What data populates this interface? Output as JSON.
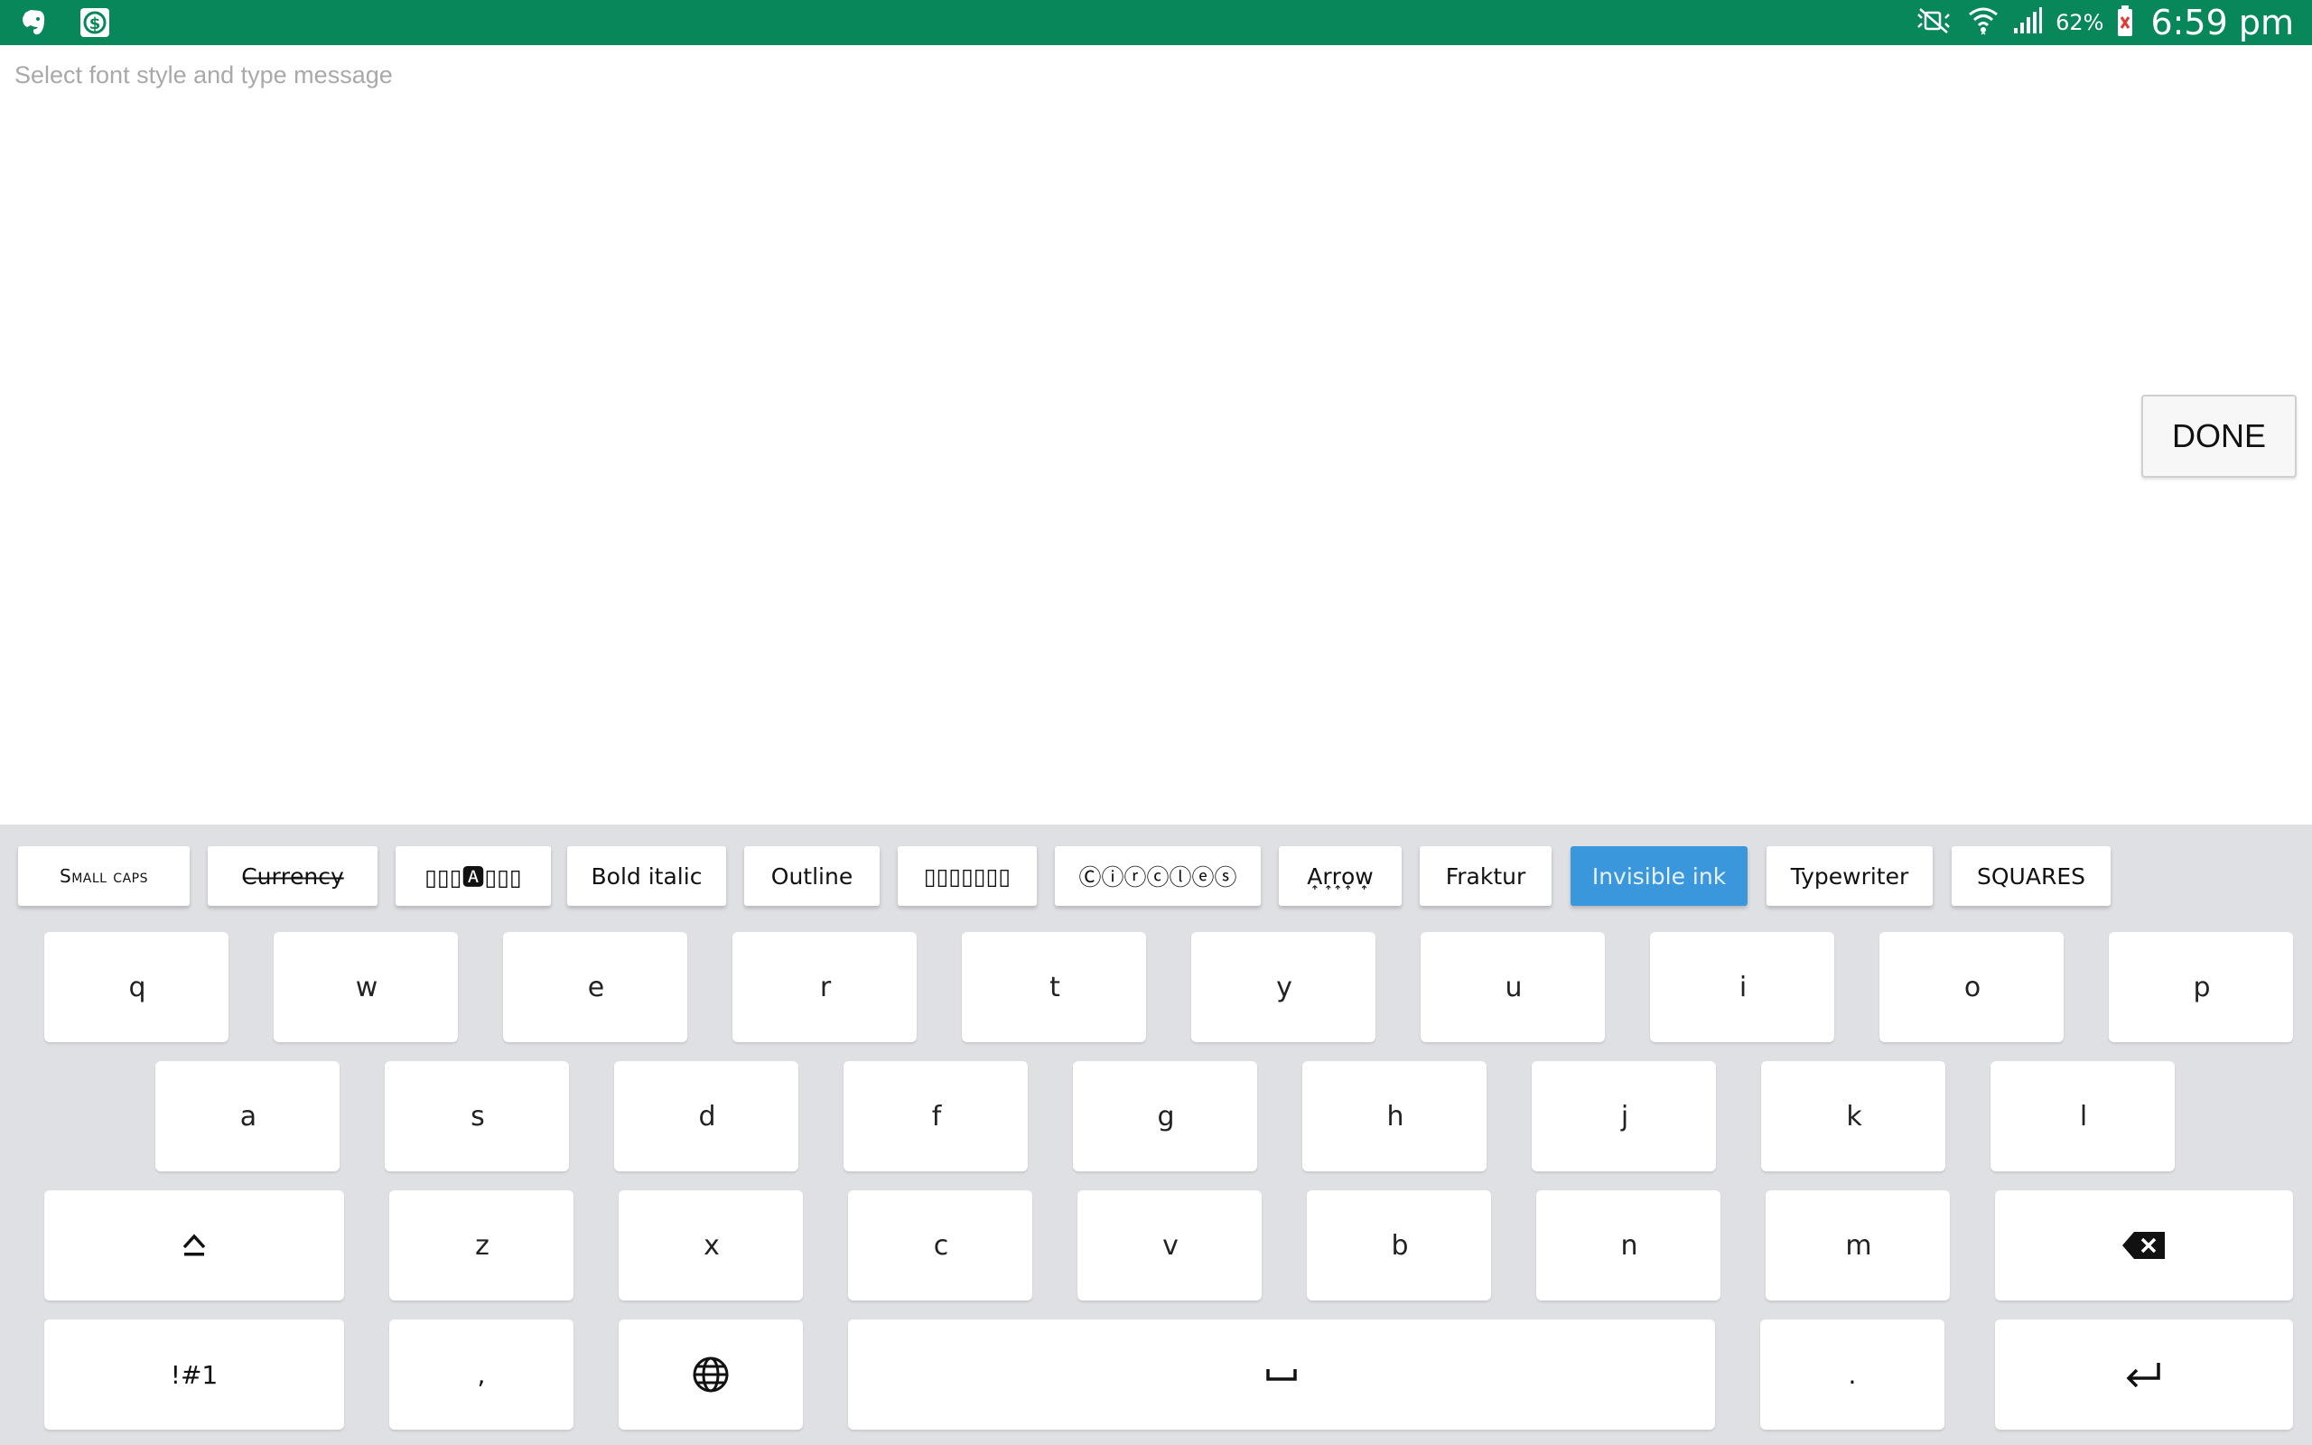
{
  "status_bar": {
    "left_icons": [
      "evernote-icon",
      "dollar-app-icon"
    ],
    "right_icons": [
      "mute-icon",
      "wifi-icon",
      "signal-icon",
      "battery-icon"
    ],
    "battery": "62%",
    "time": "6:59 pm"
  },
  "message": {
    "placeholder": "Select font style and type message",
    "value": ""
  },
  "done_label": "DONE",
  "colors": {
    "status_bar": "#07875a",
    "keyboard_bg": "#dfe0e4",
    "selected_chip": "#3b97dc"
  },
  "font_styles": [
    {
      "label": "Small caps",
      "selected": false
    },
    {
      "label": "C̶u̶r̶r̶e̶n̶c̶y̶",
      "selected": false
    },
    {
      "label": "▯▯▯🅰▯▯▯",
      "selected": false
    },
    {
      "label": "Bold italic",
      "selected": false
    },
    {
      "label": "Outline",
      "selected": false
    },
    {
      "label": "▯▯▯▯▯▯▯",
      "selected": false
    },
    {
      "label": "Ⓒⓘⓡⓒⓛⓔⓢ",
      "selected": false
    },
    {
      "label": "A͎r͎r͎o͎w͎",
      "selected": false
    },
    {
      "label": "Fraktur",
      "selected": false
    },
    {
      "label": "Invisible ink",
      "selected": true
    },
    {
      "label": "Typewriter",
      "selected": false
    },
    {
      "label": "SQUARES",
      "selected": false
    }
  ],
  "keyboard": {
    "row1": [
      "q",
      "w",
      "e",
      "r",
      "t",
      "y",
      "u",
      "i",
      "o",
      "p"
    ],
    "row2": [
      "a",
      "s",
      "d",
      "f",
      "g",
      "h",
      "j",
      "k",
      "l"
    ],
    "row3": [
      "z",
      "x",
      "c",
      "v",
      "b",
      "n",
      "m"
    ],
    "symbols_label": "!#1",
    "comma_label": ",",
    "period_label": ".",
    "icons": [
      "shift-icon",
      "backspace-icon",
      "globe-icon",
      "space-icon",
      "enter-icon"
    ]
  }
}
